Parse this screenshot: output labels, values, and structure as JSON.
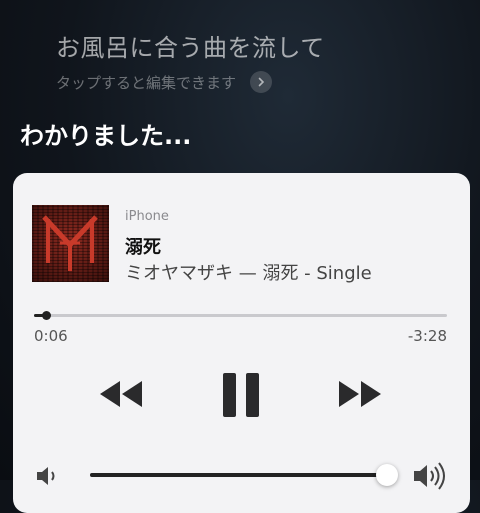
{
  "siri": {
    "query": "お風呂に合う曲を流して",
    "edit_hint": "タップすると編集できます",
    "response": "わかりました..."
  },
  "player": {
    "device": "iPhone",
    "title": "溺死",
    "subtitle": "ミオヤマザキ — 溺死 - Single",
    "artwork_icon": "album-artwork",
    "elapsed": "0:06",
    "remaining": "-3:28",
    "progress_fraction": 0.03,
    "volume_fraction": 0.99,
    "controls": {
      "rewind_icon": "rewind-icon",
      "pause_icon": "pause-icon",
      "forward_icon": "fast-forward-icon"
    }
  },
  "colors": {
    "card_background": "#f3f3f5",
    "controls": "#222222",
    "screen_background": "#10151c"
  }
}
